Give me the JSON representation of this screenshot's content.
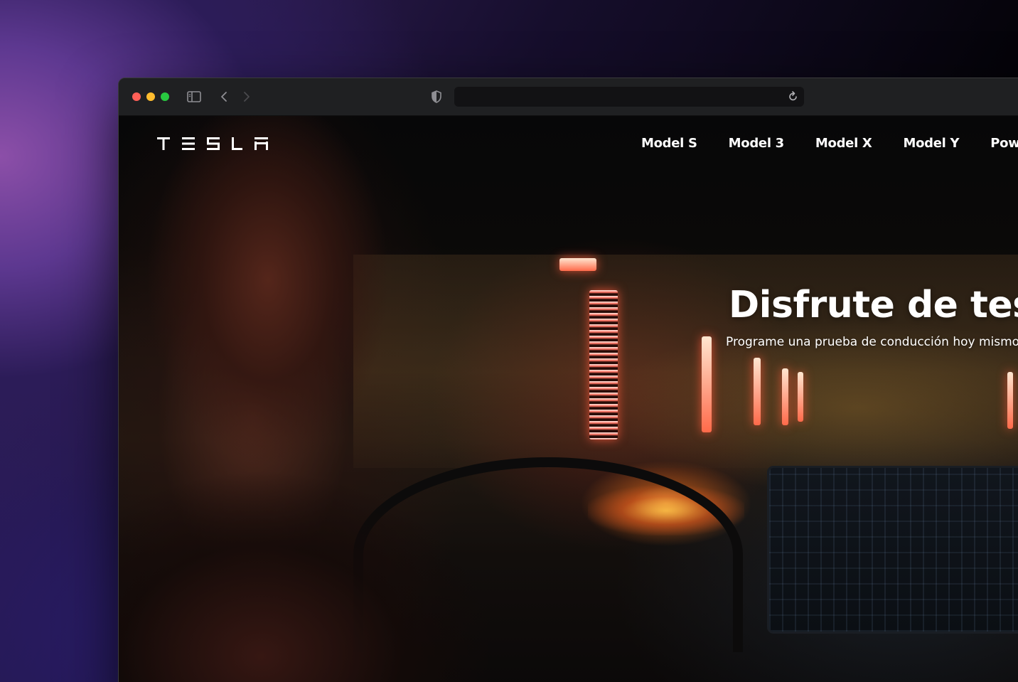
{
  "browser": {
    "url": "",
    "icons": {
      "sidebar": "sidebar-toggle-icon",
      "back": "chevron-left-icon",
      "forward": "chevron-right-icon",
      "privacy": "shield-icon",
      "reload": "reload-icon"
    }
  },
  "site": {
    "logo_text": "TESLA",
    "nav": {
      "links": [
        "Model S",
        "Model 3",
        "Model X",
        "Model Y",
        "Powerwall"
      ]
    },
    "hero": {
      "title": "Disfrute de tesla",
      "subtitle": "Programe una prueba de conducción hoy mismo"
    }
  },
  "colors": {
    "traffic_red": "#ff5f57",
    "traffic_yellow": "#febc2e",
    "traffic_green": "#28c840",
    "text": "#ffffff"
  }
}
